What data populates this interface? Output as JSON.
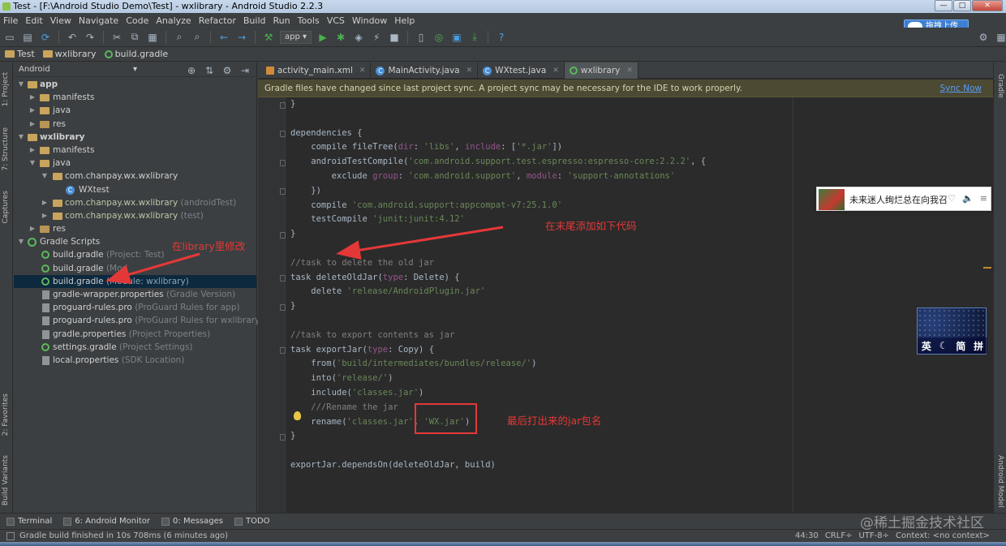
{
  "window": {
    "title": "Test - [F:\\Android Studio Demo\\Test] - wxlibrary - Android Studio 2.2.3",
    "controls": [
      "—",
      "□",
      "✕"
    ]
  },
  "menu": [
    "File",
    "Edit",
    "View",
    "Navigate",
    "Code",
    "Analyze",
    "Refactor",
    "Build",
    "Run",
    "Tools",
    "VCS",
    "Window",
    "Help"
  ],
  "toolbar": {
    "run_config": "app ▾",
    "upload_label": "拖拽上传"
  },
  "breadcrumb": {
    "project": "Test",
    "module": "wxlibrary",
    "file": "build.gradle"
  },
  "project_panel": {
    "view": "Android",
    "tree": [
      {
        "label": "app",
        "hint": "",
        "bold": true
      },
      {
        "label": "manifests",
        "hint": ""
      },
      {
        "label": "java",
        "hint": ""
      },
      {
        "label": "res",
        "hint": ""
      },
      {
        "label": "wxlibrary",
        "hint": "",
        "bold": true
      },
      {
        "label": "manifests",
        "hint": ""
      },
      {
        "label": "java",
        "hint": ""
      },
      {
        "label": "com.chanpay.wx.wxlibrary",
        "hint": ""
      },
      {
        "label": "WXtest",
        "hint": ""
      },
      {
        "label": "com.chanpay.wx.wxlibrary",
        "hint": " (androidTest)"
      },
      {
        "label": "com.chanpay.wx.wxlibrary",
        "hint": " (test)"
      },
      {
        "label": "res",
        "hint": ""
      },
      {
        "label": "Gradle Scripts",
        "hint": ""
      },
      {
        "label": "build.gradle",
        "hint": " (Project: Test)"
      },
      {
        "label": "build.gradle",
        "hint": " (Mod"
      },
      {
        "label": "build.gradle",
        "hint": " (Module: wxlibrary)"
      },
      {
        "label": "gradle-wrapper.properties",
        "hint": " (Gradle Version)"
      },
      {
        "label": "proguard-rules.pro",
        "hint": " (ProGuard Rules for app)"
      },
      {
        "label": "proguard-rules.pro",
        "hint": " (ProGuard Rules for wxlibrary)"
      },
      {
        "label": "gradle.properties",
        "hint": " (Project Properties)"
      },
      {
        "label": "settings.gradle",
        "hint": " (Project Settings)"
      },
      {
        "label": "local.properties",
        "hint": " (SDK Location)"
      }
    ]
  },
  "side_tabs": {
    "project": "1: Project",
    "structure": "7: Structure",
    "captures": "Captures",
    "favorites": "2: Favorites",
    "build_variants": "Build Variants",
    "gradle": "Gradle",
    "android_model": "Android Model"
  },
  "editor": {
    "tabs": [
      "activity_main.xml",
      "MainActivity.java",
      "WXtest.java",
      "wxlibrary"
    ],
    "banner": "Gradle files have changed since last project sync. A project sync may be necessary for the IDE to work properly.",
    "sync": "Sync Now",
    "code": {
      "brace_top": "}",
      "dependencies": "dependencies {",
      "c1a": "    compile fileTree(",
      "c1b": "dir",
      "c1c": ": ",
      "c1d": "'libs'",
      "c1e": ", ",
      "c1f": "include",
      "c1g": ": [",
      "c1h": "'*.jar'",
      "c1i": "])",
      "c2a": "    androidTestCompile(",
      "c2b": "'com.android.support.test.espresso:espresso-core:2.2.2'",
      "c2c": ", {",
      "c3a": "        exclude ",
      "c3b": "group",
      "c3c": ": ",
      "c3d": "'com.android.support'",
      "c3e": ", ",
      "c3f": "module",
      "c3g": ": ",
      "c3h": "'support-annotations'",
      "c4": "    })",
      "c5a": "    compile ",
      "c5b": "'com.android.support:appcompat-v7:25.1.0'",
      "c6a": "    testCompile ",
      "c6b": "'junit:junit:4.12'",
      "c7": "}",
      "c8": "//task to delete the old jar",
      "c9a": "task deleteOldJar(",
      "c9b": "type",
      "c9c": ": Delete) {",
      "c10a": "    delete ",
      "c10b": "'release/AndroidPlugin.jar'",
      "c11": "}",
      "c12": "//task to export contents as jar",
      "c13a": "task exportJar(",
      "c13b": "type",
      "c13c": ": Copy) {",
      "c14a": "    from(",
      "c14b": "'build/intermediates/bundles/release/'",
      "c14c": ")",
      "c15a": "    into(",
      "c15b": "'release/'",
      "c15c": ")",
      "c16a": "    include(",
      "c16b": "'classes.jar'",
      "c16c": ")",
      "c17": "    ///Rename the jar",
      "c18a": "    rename(",
      "c18b": "'classes.jar'",
      "c18c": ", ",
      "c18d": "'WX.jar'",
      "c18e": ")",
      "c19": "}",
      "c20": "exportJar.dependsOn(deleteOldJar, build)"
    }
  },
  "annotations": {
    "modify_in_library": "在library里修改",
    "append_code": "在末尾添加如下代码",
    "jar_name": "最后打出来的jar包名"
  },
  "notification": {
    "text": "未来迷人绚烂总在向我召"
  },
  "ime": {
    "labels": [
      "英",
      "☾",
      "简",
      "拼"
    ]
  },
  "bottom_tools": [
    "Terminal",
    "6: Android Monitor",
    "0: Messages",
    "TODO"
  ],
  "status": {
    "message": "Gradle build finished in 10s 708ms (6 minutes ago)",
    "position": "44:30",
    "line_sep": "CRLF÷",
    "encoding": "UTF-8÷",
    "context": "Context: <no context>"
  },
  "watermark": "@稀土掘金技术社区",
  "colors": {
    "background": "#2b2b2b",
    "panel": "#3c3f41",
    "keyword": "#cc7832",
    "string": "#6a8759",
    "comment": "#808080",
    "annotation": "#e43838",
    "selection": "#0d293e",
    "banner": "#4c4a33"
  }
}
